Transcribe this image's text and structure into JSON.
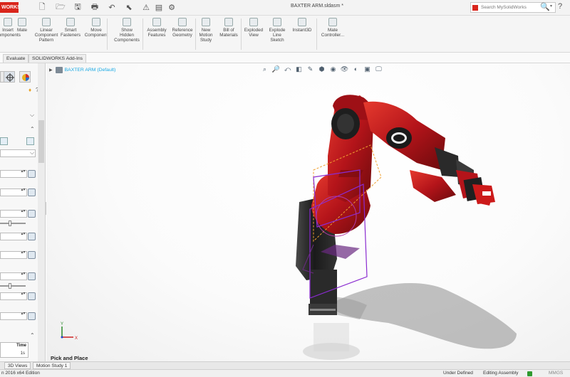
{
  "app": {
    "logo_text": "WORKS",
    "document_title": "BAXTER ARM.sldasm *",
    "search_placeholder": "Search MySolidWorks",
    "search_button_glyph": "🔍",
    "search_dropdown_glyph": "▾",
    "help_glyph": "?"
  },
  "quick_access": [
    {
      "name": "new-doc-icon",
      "glyph": "🗋"
    },
    {
      "name": "open-icon",
      "glyph": "🗁"
    },
    {
      "name": "save-icon",
      "glyph": "🖫"
    },
    {
      "name": "print-icon",
      "glyph": "🖶"
    },
    {
      "name": "undo-icon",
      "glyph": "↶"
    },
    {
      "name": "select-icon",
      "glyph": "⬉"
    },
    {
      "name": "rebuild-icon",
      "glyph": "⚠"
    },
    {
      "name": "file-props-icon",
      "glyph": "▤"
    },
    {
      "name": "options-icon",
      "glyph": "⚙"
    }
  ],
  "ribbon": {
    "buttons": [
      {
        "label": "Insert\nComponents",
        "name": "insert-components-button"
      },
      {
        "label": "Mate",
        "name": "mate-button"
      },
      {
        "label": "Linear\nComponent\nPattern",
        "name": "linear-component-pattern-button"
      },
      {
        "label": "Smart\nFasteners",
        "name": "smart-fasteners-button"
      },
      {
        "label": "Move\nComponent",
        "name": "move-component-button"
      },
      {
        "label": "Show\nHidden\nComponents",
        "name": "show-hidden-components-button"
      },
      {
        "label": "Assembly\nFeatures",
        "name": "assembly-features-button"
      },
      {
        "label": "Reference\nGeometry",
        "name": "reference-geometry-button"
      },
      {
        "label": "New\nMotion\nStudy",
        "name": "new-motion-study-button"
      },
      {
        "label": "Bill of\nMaterials",
        "name": "bill-of-materials-button"
      },
      {
        "label": "Exploded\nView",
        "name": "exploded-view-button"
      },
      {
        "label": "Explode\nLine\nSketch",
        "name": "explode-line-sketch-button"
      },
      {
        "label": "Instant3D",
        "name": "instant3d-button"
      },
      {
        "label": "Mate\nController...",
        "name": "mate-controller-button"
      }
    ]
  },
  "command_tabs": [
    "Evaluate",
    "SOLIDWORKS Add-Ins"
  ],
  "left_panel": {
    "fields": [
      "0",
      "0",
      "0",
      "0",
      "0",
      "0",
      "0",
      "0",
      "0",
      "0"
    ],
    "time_table": {
      "header": "Time",
      "value": "1s"
    }
  },
  "viewport": {
    "tree_root": "BAXTER ARM (Default)",
    "studio_label": "Pick and Place",
    "triad": {
      "x_label": "X",
      "y_label": "Y"
    },
    "view_tools": [
      {
        "name": "zoom-to-fit-icon",
        "glyph": "⌕"
      },
      {
        "name": "zoom-area-icon",
        "glyph": "🔎"
      },
      {
        "name": "previous-view-icon",
        "glyph": "⤺"
      },
      {
        "name": "section-view-icon",
        "glyph": "◧"
      },
      {
        "name": "dynamic-annotation-icon",
        "glyph": "✎"
      },
      {
        "name": "view-orientation-icon",
        "glyph": "⬢"
      },
      {
        "name": "display-style-icon",
        "glyph": "◉"
      },
      {
        "name": "hide-show-icon",
        "glyph": "👁"
      },
      {
        "name": "edit-appearance-icon",
        "glyph": "◐"
      },
      {
        "name": "apply-scene-icon",
        "glyph": "▣"
      },
      {
        "name": "view-settings-icon",
        "glyph": "🖵"
      }
    ]
  },
  "bottom_tabs": [
    "3D Views",
    "Motion Study 1"
  ],
  "status_bar": {
    "edition": "n 2016 x64 Edition",
    "state": "Under Defined",
    "mode": "Editing Assembly",
    "units": "MMGS"
  },
  "colors": {
    "brand_red": "#d9261c",
    "robot_red": "#c4161c",
    "tree_blue": "#18a9e4"
  }
}
